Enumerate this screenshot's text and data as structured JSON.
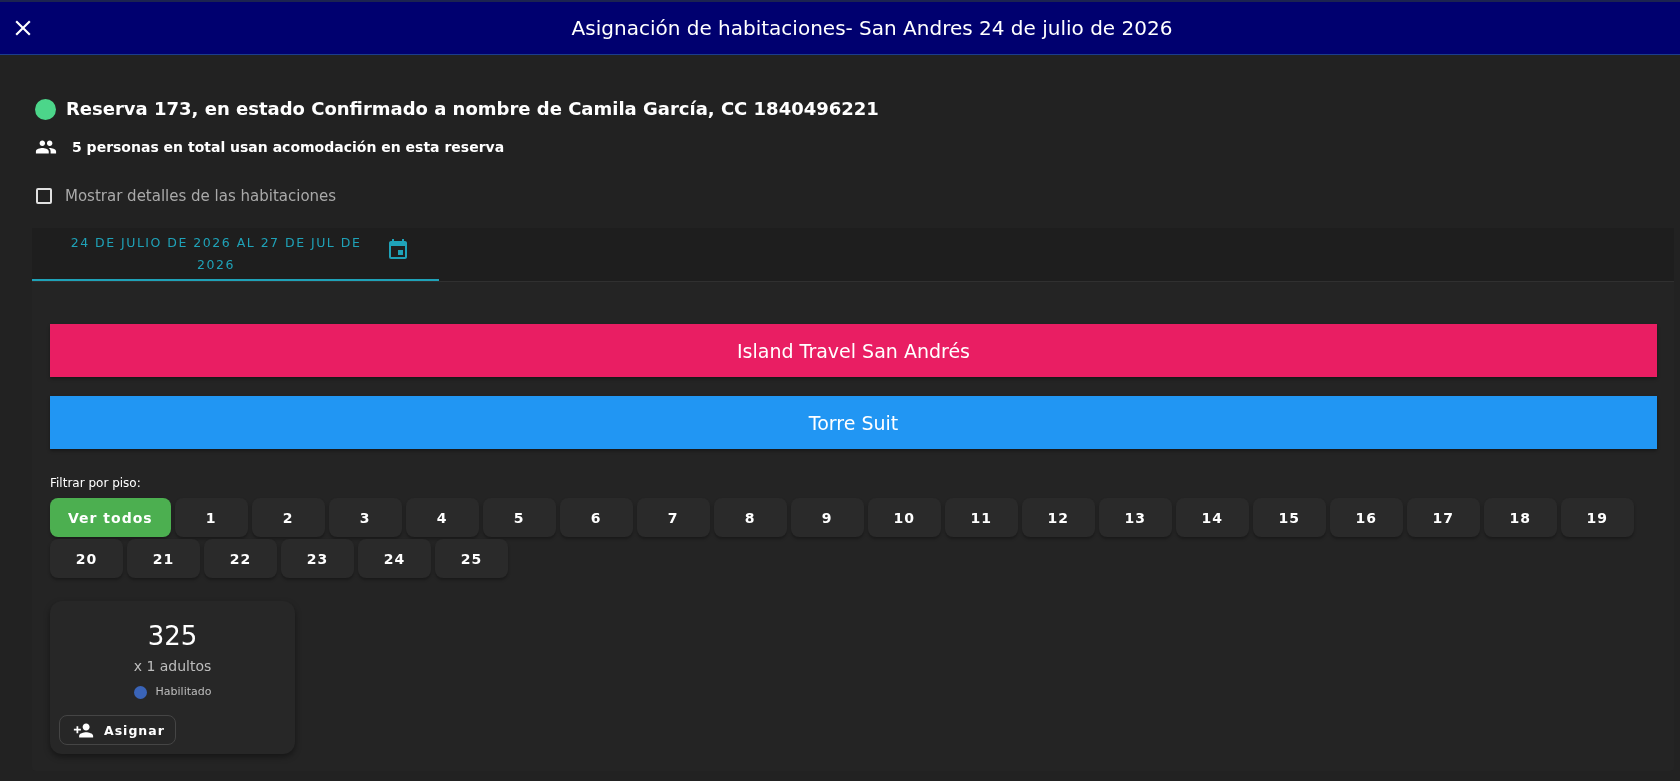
{
  "header": {
    "title": "Asignación de habitaciones- San Andres 24 de julio de 2026"
  },
  "reservation": {
    "summary": "Reserva 173, en estado Confirmado a nombre de Camila García, CC 1840496221",
    "color": "#4cd68a",
    "people": "5 personas en total usan acomodación en esta reserva"
  },
  "details_toggle": {
    "label": "Mostrar detalles de las habitaciones",
    "checked": false
  },
  "tabs": [
    {
      "label": "24 DE JULIO DE 2026 AL 27 DE JUL DE 2026",
      "selected": true
    }
  ],
  "sections": [
    {
      "label": "Island Travel San Andrés",
      "color": "#e91e63"
    },
    {
      "label": "Torre Suit",
      "color": "#2196f3"
    }
  ],
  "floor_filter": {
    "label": "Filtrar por piso:",
    "options": [
      {
        "label": "Ver todos",
        "selected": true
      },
      {
        "label": "1",
        "selected": false
      },
      {
        "label": "2",
        "selected": false
      },
      {
        "label": "3",
        "selected": false
      },
      {
        "label": "4",
        "selected": false
      },
      {
        "label": "5",
        "selected": false
      },
      {
        "label": "6",
        "selected": false
      },
      {
        "label": "7",
        "selected": false
      },
      {
        "label": "8",
        "selected": false
      },
      {
        "label": "9",
        "selected": false
      },
      {
        "label": "10",
        "selected": false
      },
      {
        "label": "11",
        "selected": false
      },
      {
        "label": "12",
        "selected": false
      },
      {
        "label": "13",
        "selected": false
      },
      {
        "label": "14",
        "selected": false
      },
      {
        "label": "15",
        "selected": false
      },
      {
        "label": "16",
        "selected": false
      },
      {
        "label": "17",
        "selected": false
      },
      {
        "label": "18",
        "selected": false
      },
      {
        "label": "19",
        "selected": false
      },
      {
        "label": "20",
        "selected": false
      },
      {
        "label": "21",
        "selected": false
      },
      {
        "label": "22",
        "selected": false
      },
      {
        "label": "23",
        "selected": false
      },
      {
        "label": "24",
        "selected": false
      },
      {
        "label": "25",
        "selected": false
      }
    ]
  },
  "rooms": [
    {
      "number": "325",
      "occupancy": "x 1 adultos",
      "status": "Habilitado",
      "color": "#3a64b8",
      "action": "Asignar"
    }
  ]
}
